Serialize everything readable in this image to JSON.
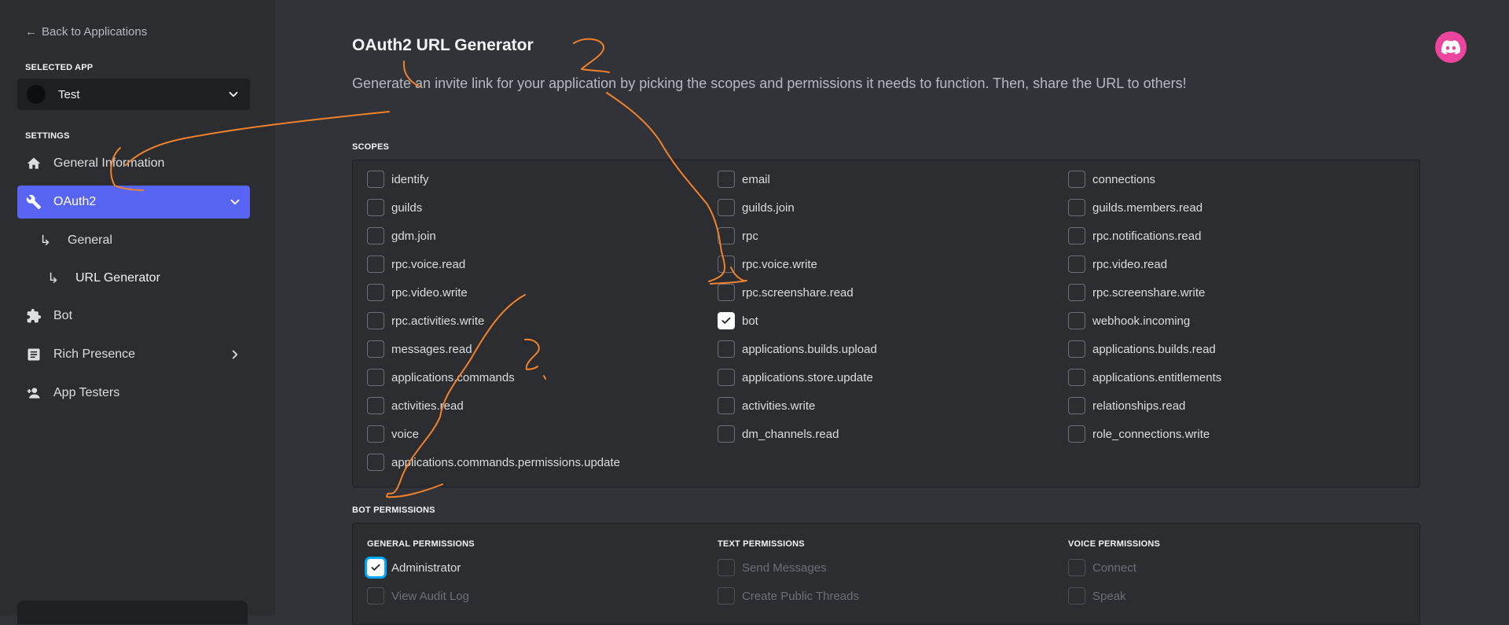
{
  "sidebar": {
    "back_label": "Back to Applications",
    "selected_app_label": "SELECTED APP",
    "selected_app_name": "Test",
    "settings_label": "SETTINGS",
    "items": [
      {
        "label": "General Information",
        "icon": "home-icon"
      },
      {
        "label": "OAuth2",
        "icon": "wrench-icon"
      },
      {
        "label": "Bot",
        "icon": "puzzle-icon"
      },
      {
        "label": "Rich Presence",
        "icon": "document-icon"
      },
      {
        "label": "App Testers",
        "icon": "person-add-icon"
      }
    ],
    "sub_items": [
      "General",
      "URL Generator"
    ]
  },
  "header": {
    "title": "OAuth2 URL Generator",
    "description": "Generate an invite link for your application by picking the scopes and permissions it needs to function. Then, share the URL to others!"
  },
  "scopes": {
    "label": "SCOPES",
    "columns": [
      [
        {
          "label": "identify",
          "checked": false
        },
        {
          "label": "guilds",
          "checked": false
        },
        {
          "label": "gdm.join",
          "checked": false
        },
        {
          "label": "rpc.voice.read",
          "checked": false
        },
        {
          "label": "rpc.video.write",
          "checked": false
        },
        {
          "label": "rpc.activities.write",
          "checked": false
        },
        {
          "label": "messages.read",
          "checked": false
        },
        {
          "label": "applications.commands",
          "checked": false
        },
        {
          "label": "activities.read",
          "checked": false
        },
        {
          "label": "voice",
          "checked": false
        },
        {
          "label": "applications.commands.permissions.update",
          "checked": false
        }
      ],
      [
        {
          "label": "email",
          "checked": false
        },
        {
          "label": "guilds.join",
          "checked": false
        },
        {
          "label": "rpc",
          "checked": false
        },
        {
          "label": "rpc.voice.write",
          "checked": false
        },
        {
          "label": "rpc.screenshare.read",
          "checked": false
        },
        {
          "label": "bot",
          "checked": true
        },
        {
          "label": "applications.builds.upload",
          "checked": false
        },
        {
          "label": "applications.store.update",
          "checked": false
        },
        {
          "label": "activities.write",
          "checked": false
        },
        {
          "label": "dm_channels.read",
          "checked": false
        }
      ],
      [
        {
          "label": "connections",
          "checked": false
        },
        {
          "label": "guilds.members.read",
          "checked": false
        },
        {
          "label": "rpc.notifications.read",
          "checked": false
        },
        {
          "label": "rpc.video.read",
          "checked": false
        },
        {
          "label": "rpc.screenshare.write",
          "checked": false
        },
        {
          "label": "webhook.incoming",
          "checked": false
        },
        {
          "label": "applications.builds.read",
          "checked": false
        },
        {
          "label": "applications.entitlements",
          "checked": false
        },
        {
          "label": "relationships.read",
          "checked": false
        },
        {
          "label": "role_connections.write",
          "checked": false
        }
      ]
    ]
  },
  "bot_permissions": {
    "label": "BOT PERMISSIONS",
    "columns": [
      {
        "heading": "GENERAL PERMISSIONS",
        "items": [
          {
            "label": "Administrator",
            "checked": true,
            "disabled": false
          },
          {
            "label": "View Audit Log",
            "checked": false,
            "disabled": true
          }
        ]
      },
      {
        "heading": "TEXT PERMISSIONS",
        "items": [
          {
            "label": "Send Messages",
            "checked": false,
            "disabled": true
          },
          {
            "label": "Create Public Threads",
            "checked": false,
            "disabled": true
          }
        ]
      },
      {
        "heading": "VOICE PERMISSIONS",
        "items": [
          {
            "label": "Connect",
            "checked": false,
            "disabled": true
          },
          {
            "label": "Speak",
            "checked": false,
            "disabled": true
          }
        ]
      }
    ]
  },
  "colors": {
    "accent": "#5865f2",
    "annotation": "#f0822d",
    "badge": "#eb459e"
  }
}
